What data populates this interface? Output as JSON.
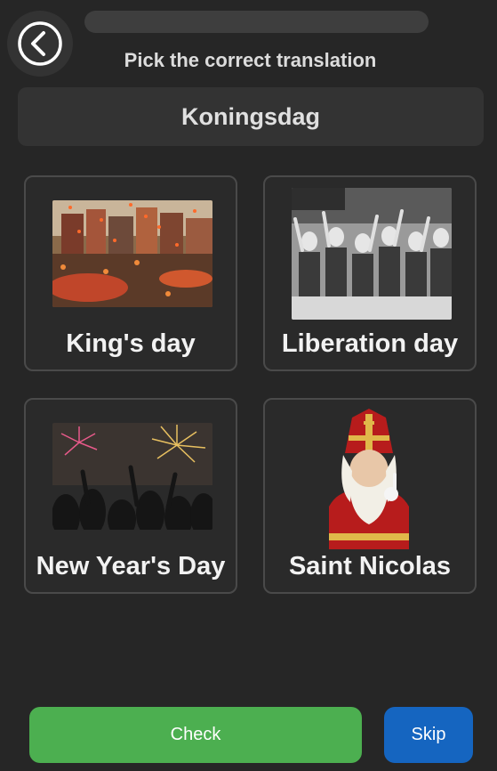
{
  "header": {
    "back_icon": "chevron-left-circle-icon",
    "progress_fraction": 0.0,
    "instruction": "Pick the correct translation"
  },
  "question": {
    "word": "Koningsdag"
  },
  "options": [
    {
      "label": "King's day",
      "image": "canal-party-confetti-image"
    },
    {
      "label": "Liberation day",
      "image": "celebrating-crowd-photo"
    },
    {
      "label": "New Year's Day",
      "image": "fireworks-crowd-image"
    },
    {
      "label": "Saint Nicolas",
      "image": "saint-nicolas-image"
    }
  ],
  "footer": {
    "check_label": "Check",
    "skip_label": "Skip"
  },
  "colors": {
    "background": "#262626",
    "check": "#4caf50",
    "skip": "#1565c0"
  }
}
